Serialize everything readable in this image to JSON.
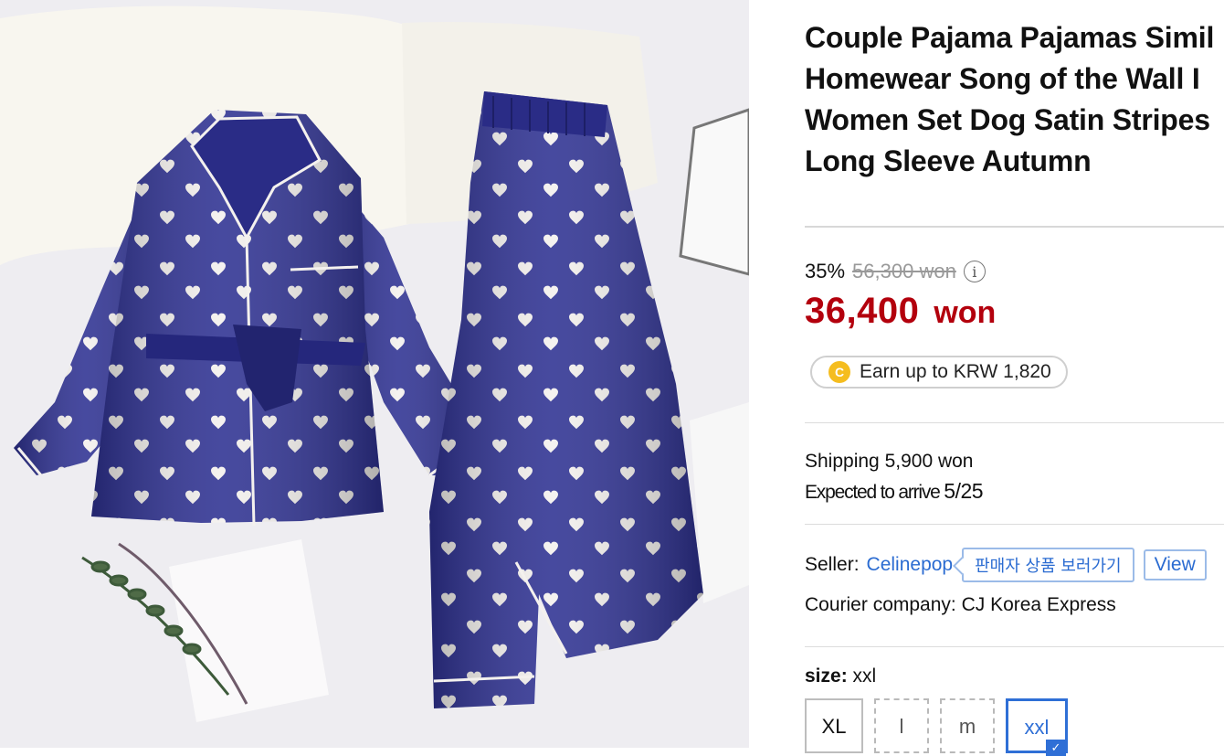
{
  "product": {
    "image_alt": "Navy satin pajama set with white hearts",
    "title": "Couple Pajama Pajamas Simil\nHomewear Song of the Wall I\nWomen Set Dog Satin Stripes\nLong Sleeve Autumn"
  },
  "price": {
    "discount": "35%",
    "original": "56,300 won",
    "sale_amount": "36,400",
    "sale_unit": "won",
    "info_icon": "info-icon"
  },
  "points": {
    "coin_letter": "C",
    "label": "Earn up to KRW 1,820"
  },
  "shipping": {
    "cost": "Shipping 5,900 won",
    "arrival_prefix": "Expected to arrive ",
    "arrival_date": "5/25"
  },
  "seller": {
    "label": "Seller:",
    "name": "Celinepop",
    "view_products_button": "판매자 상품 보러가기",
    "view_button": "View",
    "courier": "Courier company: CJ Korea Express"
  },
  "size": {
    "label": "size:",
    "selected_value": "xxl",
    "options": [
      {
        "label": "XL",
        "state": "available"
      },
      {
        "label": "l",
        "state": "disabled"
      },
      {
        "label": "m",
        "state": "disabled"
      },
      {
        "label": "xxl",
        "state": "selected"
      }
    ]
  },
  "colors": {
    "accent_blue": "#2a6bd1",
    "sale_red": "#b3000d",
    "pajama_navy": "#2d2f8f"
  }
}
